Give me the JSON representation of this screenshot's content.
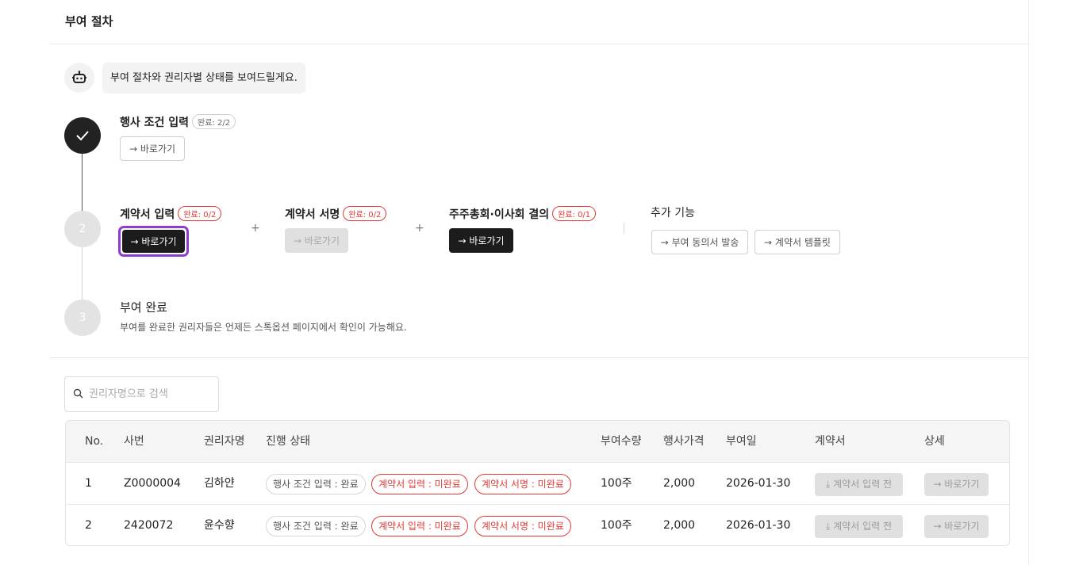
{
  "header": {
    "title": "부여 절차"
  },
  "bot": {
    "icon": "robot-icon",
    "message": "부여 절차와 권리자별 상태를 보여드릴게요."
  },
  "steps": {
    "step1": {
      "status": "done",
      "title": "행사 조건 입력",
      "badge": "완료: 2/2",
      "button": "→ 바로가기"
    },
    "step2": {
      "number": "2",
      "tasks": [
        {
          "title": "계약서 입력",
          "badge": "완료: 0/2",
          "button": "→ 바로가기",
          "state": "focused"
        },
        {
          "title": "계약서 서명",
          "badge": "완료: 0/2",
          "button": "→ 바로가기",
          "state": "disabled"
        },
        {
          "title": "주주총회·이사회 결의",
          "badge": "완료: 0/1",
          "button": "→ 바로가기",
          "state": "active"
        }
      ],
      "plus": "+",
      "extra": {
        "title": "추가 기능",
        "buttons": [
          "→ 부여 동의서 발송",
          "→ 계약서 템플릿"
        ]
      }
    },
    "step3": {
      "number": "3",
      "title": "부여 완료",
      "description": "부여를 완료한 권리자들은 언제든 스톡옵션 페이지에서 확인이 가능해요."
    }
  },
  "search": {
    "placeholder": "권리자명으로 검색",
    "value": ""
  },
  "table": {
    "columns": [
      "No.",
      "사번",
      "권리자명",
      "진행 상태",
      "부여수량",
      "행사가격",
      "부여일",
      "계약서",
      "상세"
    ],
    "rows": [
      {
        "no": "1",
        "emp_id": "Z0000004",
        "name": "김하얀",
        "status": [
          "행사 조건 입력 : 완료",
          "계약서 입력 : 미완료",
          "계약서 서명 : 미완료"
        ],
        "quantity": "100주",
        "price": "2,000",
        "date": "2026-01-30",
        "contract_btn": "계약서 입력 전",
        "detail_btn": "→ 바로가기"
      },
      {
        "no": "2",
        "emp_id": "2420072",
        "name": "윤수향",
        "status": [
          "행사 조건 입력 : 완료",
          "계약서 입력 : 미완료",
          "계약서 서명 : 미완료"
        ],
        "quantity": "100주",
        "price": "2,000",
        "date": "2026-01-30",
        "contract_btn": "계약서 입력 전",
        "detail_btn": "→ 바로가기"
      }
    ]
  },
  "colors": {
    "accent_focus": "#8e3bd0",
    "danger": "#e53935",
    "dark": "#1c1c1c"
  }
}
